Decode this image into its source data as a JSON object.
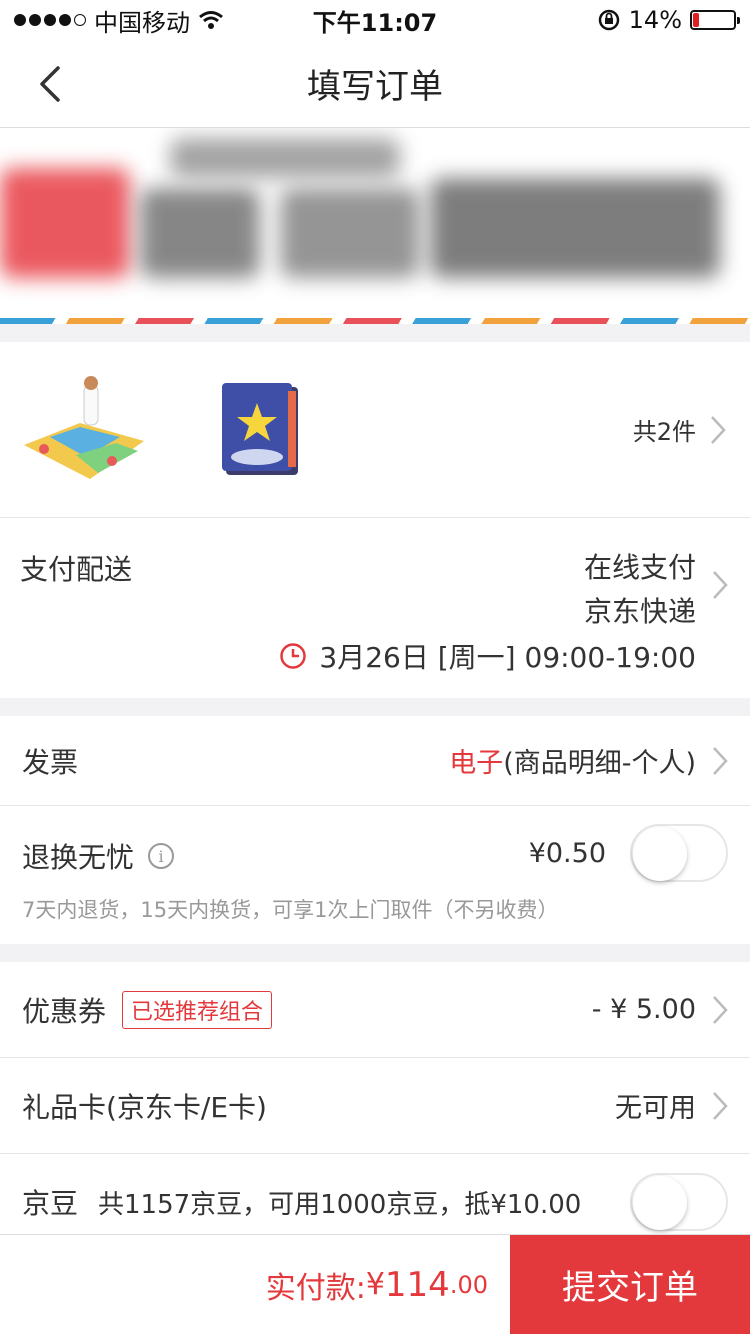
{
  "status_bar": {
    "carrier": "中国移动",
    "time": "下午11:07",
    "battery": "14%",
    "battery_level": 0.14
  },
  "nav": {
    "title": "填写订单"
  },
  "products": {
    "count_label": "共2件"
  },
  "delivery": {
    "label": "支付配送",
    "payment": "在线支付",
    "shipping": "京东快递",
    "time": "3月26日 [周一] 09:00-19:00"
  },
  "invoice": {
    "label": "发票",
    "type_highlight": "电子",
    "type_detail": "(商品明细-个人)"
  },
  "return_service": {
    "label": "退换无忧",
    "price": "¥0.50",
    "description": "7天内退货，15天内换货，可享1次上门取件（不另收费）",
    "enabled": false
  },
  "coupon": {
    "label": "优惠券",
    "tag": "已选推荐组合",
    "value": "- ¥ 5.00"
  },
  "gift_card": {
    "label": "礼品卡(京东卡/E卡)",
    "value": "无可用"
  },
  "jingdou": {
    "label": "京豆",
    "detail": "共1157京豆，可用1000京豆，抵¥10.00",
    "enabled": false
  },
  "footer": {
    "total_label": "实付款:",
    "total_currency": "¥",
    "total_int": "114",
    "total_dec": ".00",
    "submit_label": "提交订单"
  },
  "colors": {
    "accent": "#e4393c"
  }
}
